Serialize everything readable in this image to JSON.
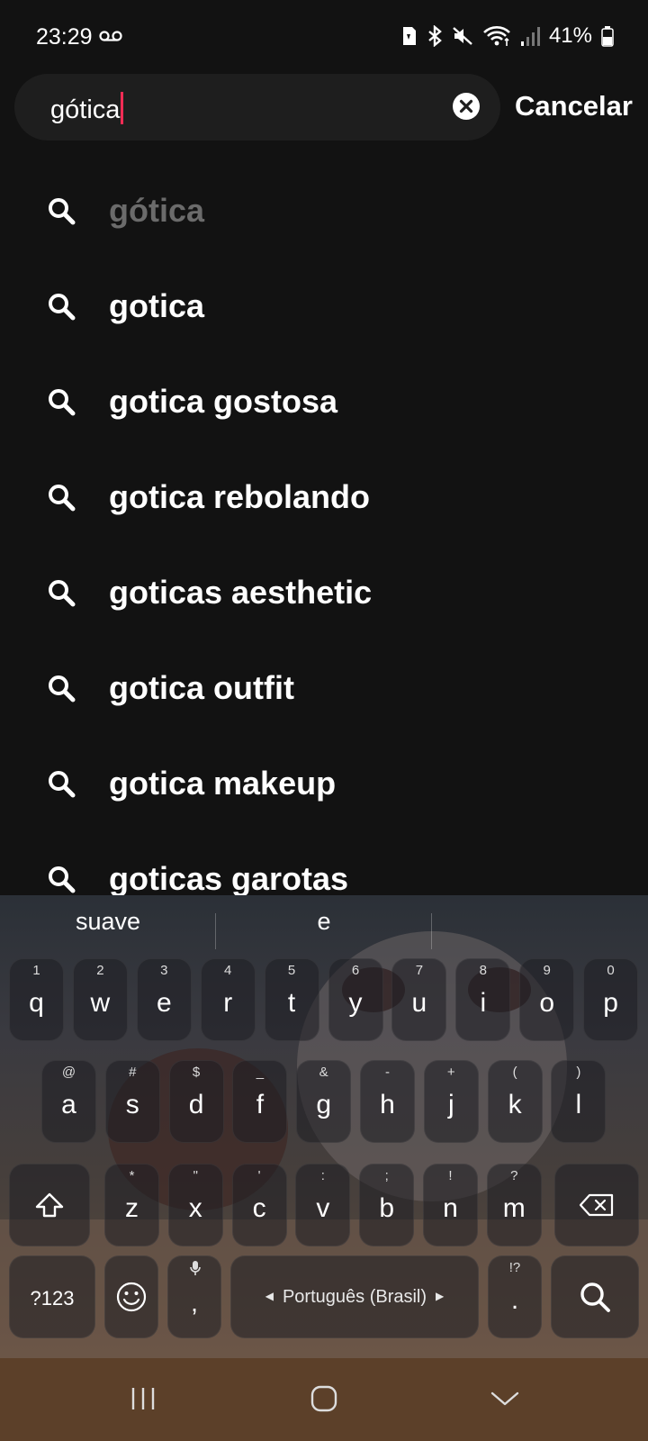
{
  "status_bar": {
    "time": "23:29",
    "battery": "41%"
  },
  "search": {
    "query": "gótica",
    "cancel_label": "Cancelar"
  },
  "suggestions": [
    {
      "label": "gótica",
      "dim": true
    },
    {
      "label": "gotica",
      "dim": false
    },
    {
      "label": "gotica gostosa",
      "dim": false
    },
    {
      "label": "gotica rebolando",
      "dim": false
    },
    {
      "label": "goticas aesthetic",
      "dim": false
    },
    {
      "label": "gotica outfit",
      "dim": false
    },
    {
      "label": "gotica makeup",
      "dim": false
    },
    {
      "label": "goticas garotas",
      "dim": false
    }
  ],
  "keyboard": {
    "predictions": [
      "suave",
      "e",
      ""
    ],
    "row1": [
      {
        "key": "q",
        "hint": "1"
      },
      {
        "key": "w",
        "hint": "2"
      },
      {
        "key": "e",
        "hint": "3"
      },
      {
        "key": "r",
        "hint": "4"
      },
      {
        "key": "t",
        "hint": "5"
      },
      {
        "key": "y",
        "hint": "6"
      },
      {
        "key": "u",
        "hint": "7"
      },
      {
        "key": "i",
        "hint": "8"
      },
      {
        "key": "o",
        "hint": "9"
      },
      {
        "key": "p",
        "hint": "0"
      }
    ],
    "row2": [
      {
        "key": "a",
        "hint": "@"
      },
      {
        "key": "s",
        "hint": "#"
      },
      {
        "key": "d",
        "hint": "$"
      },
      {
        "key": "f",
        "hint": "_"
      },
      {
        "key": "g",
        "hint": "&"
      },
      {
        "key": "h",
        "hint": "-"
      },
      {
        "key": "j",
        "hint": "+"
      },
      {
        "key": "k",
        "hint": "("
      },
      {
        "key": "l",
        "hint": ")"
      }
    ],
    "row3": [
      {
        "key": "z",
        "hint": "*"
      },
      {
        "key": "x",
        "hint": "\""
      },
      {
        "key": "c",
        "hint": "'"
      },
      {
        "key": "v",
        "hint": ":"
      },
      {
        "key": "b",
        "hint": ";"
      },
      {
        "key": "n",
        "hint": "!"
      },
      {
        "key": "m",
        "hint": "?"
      }
    ],
    "symbols_label": "?123",
    "comma_label": ",",
    "space_label": "Português (Brasil)",
    "period_label": ".",
    "period_hint": "!?"
  }
}
